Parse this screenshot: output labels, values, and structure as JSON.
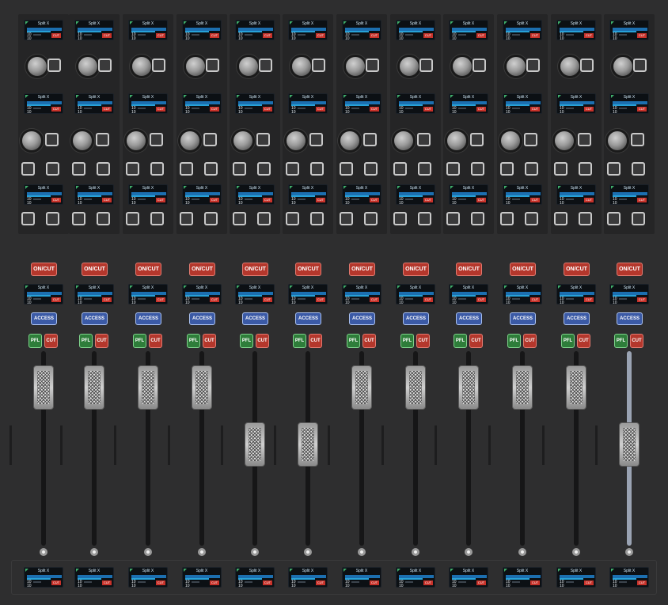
{
  "colors": {
    "panel": "#2e2e2f",
    "cut_red": "#b4372c",
    "access_blue": "#3b5aa6",
    "pfl_green": "#2e7d3a",
    "display_bar": "#1c6fb0"
  },
  "display": {
    "title": "Split X",
    "line1": "10",
    "line2": "10",
    "badge": "CUT"
  },
  "buttons": {
    "on_cut": "ON/CUT",
    "access": "ACCESS",
    "pfl": "PFL",
    "cut": "CUT"
  },
  "icons": {
    "knob": "rotary-encoder",
    "square": "square-button",
    "fader": "fader-cap",
    "dot": "reset-dot"
  },
  "channels": [
    {
      "fader_level": 0.8
    },
    {
      "fader_level": 0.8
    },
    {
      "fader_level": 0.8
    },
    {
      "fader_level": 0.8
    },
    {
      "fader_level": 0.55
    },
    {
      "fader_level": 0.55
    },
    {
      "fader_level": 0.8
    },
    {
      "fader_level": 0.8
    },
    {
      "fader_level": 0.8
    },
    {
      "fader_level": 0.8
    },
    {
      "fader_level": 0.8
    },
    {
      "fader_level": 0.55
    }
  ]
}
